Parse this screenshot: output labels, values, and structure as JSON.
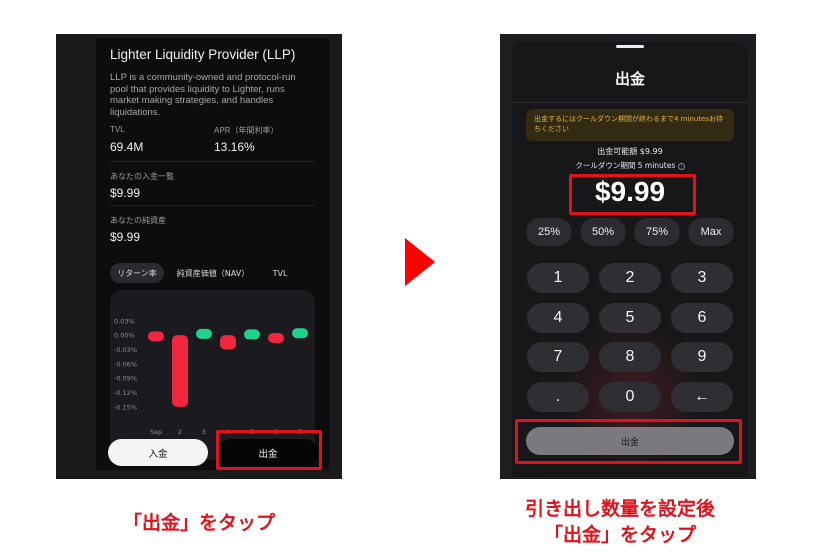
{
  "left": {
    "title": "Lighter Liquidity Provider (LLP)",
    "description": "LLP is a community-owned and protocol-run pool that provides liquidity to Lighter, runs market making strategies, and handles liquidations.",
    "tvl_label": "TVL",
    "tvl_value": "69.4M",
    "apr_label": "APR（年間利率）",
    "apr_value": "13.16%",
    "deposit_history_label": "あなたの入金一覧",
    "deposit_history_value": "$9.99",
    "net_assets_label": "あなたの純資産",
    "net_assets_value": "$9.99",
    "tabs": [
      "リターン率",
      "純資産価値（NAV）",
      "TVL"
    ],
    "deposit_button": "入金",
    "withdraw_button": "出金"
  },
  "chart_data": {
    "type": "bar",
    "categories": [
      "Sep",
      "2",
      "3",
      "4",
      "5",
      "6",
      "7"
    ],
    "values": [
      -0.005,
      -0.15,
      0.005,
      -0.03,
      0.003,
      -0.012,
      0.008
    ],
    "ytick_labels": [
      "0.03%",
      "0.00%",
      "-0.03%",
      "-0.06%",
      "-0.09%",
      "-0.12%",
      "-0.15%"
    ],
    "ylim": [
      -0.165,
      0.04
    ],
    "colors": {
      "positive": "#1fd28a",
      "negative": "#f0263f"
    },
    "grid": false
  },
  "right": {
    "title": "出金",
    "notice": "出金するにはクールダウン期間が終わるまで4 minutesお待ちください",
    "available": "出金可能額 $9.99",
    "cooldown": "クールダウン期間 5 minutes",
    "amount": "$9.99",
    "percent_buttons": [
      "25%",
      "50%",
      "75%",
      "Max"
    ],
    "keys": [
      "1",
      "2",
      "3",
      "4",
      "5",
      "6",
      "7",
      "8",
      "9",
      ".",
      "0",
      "←"
    ],
    "withdraw_button": "出金"
  },
  "captions": {
    "left": "「出金」をタップ",
    "right_line1": "引き出し数量を設定後",
    "right_line2": "「出金」をタップ"
  }
}
